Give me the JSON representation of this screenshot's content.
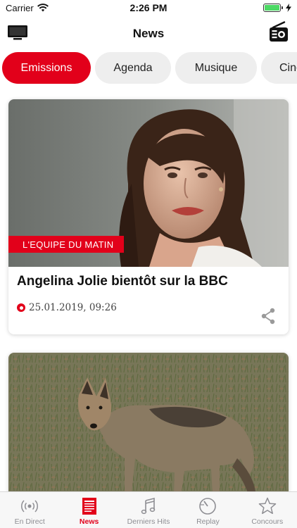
{
  "status_bar": {
    "carrier": "Carrier",
    "time": "2:26 PM",
    "battery_level": 1.0
  },
  "header": {
    "title": "News",
    "left_icon": "tv-icon",
    "right_icon": "radio-icon"
  },
  "tabs": [
    {
      "label": "Emissions",
      "active": true
    },
    {
      "label": "Agenda",
      "active": false
    },
    {
      "label": "Musique",
      "active": false
    },
    {
      "label": "Ciné",
      "active": false
    }
  ],
  "articles": [
    {
      "tag": "L'EQUIPE DU MATIN",
      "title": "Angelina Jolie bientôt sur la BBC",
      "date": "25.01.2019, 09:26",
      "image": "portrait-photo"
    },
    {
      "tag": "",
      "title": "",
      "date": "",
      "image": "jackal-photo"
    }
  ],
  "tab_bar": [
    {
      "label": "En Direct",
      "icon": "broadcast-icon",
      "active": false
    },
    {
      "label": "News",
      "icon": "newspaper-icon",
      "active": true
    },
    {
      "label": "Derniers Hits",
      "icon": "music-note-icon",
      "active": false
    },
    {
      "label": "Replay",
      "icon": "replay-icon",
      "active": false
    },
    {
      "label": "Concours",
      "icon": "star-icon",
      "active": false
    }
  ],
  "colors": {
    "accent": "#e2001a",
    "tab_inactive_bg": "#eeeeee",
    "tab_bar_inactive": "#8e8e93",
    "battery": "#4cd964"
  }
}
